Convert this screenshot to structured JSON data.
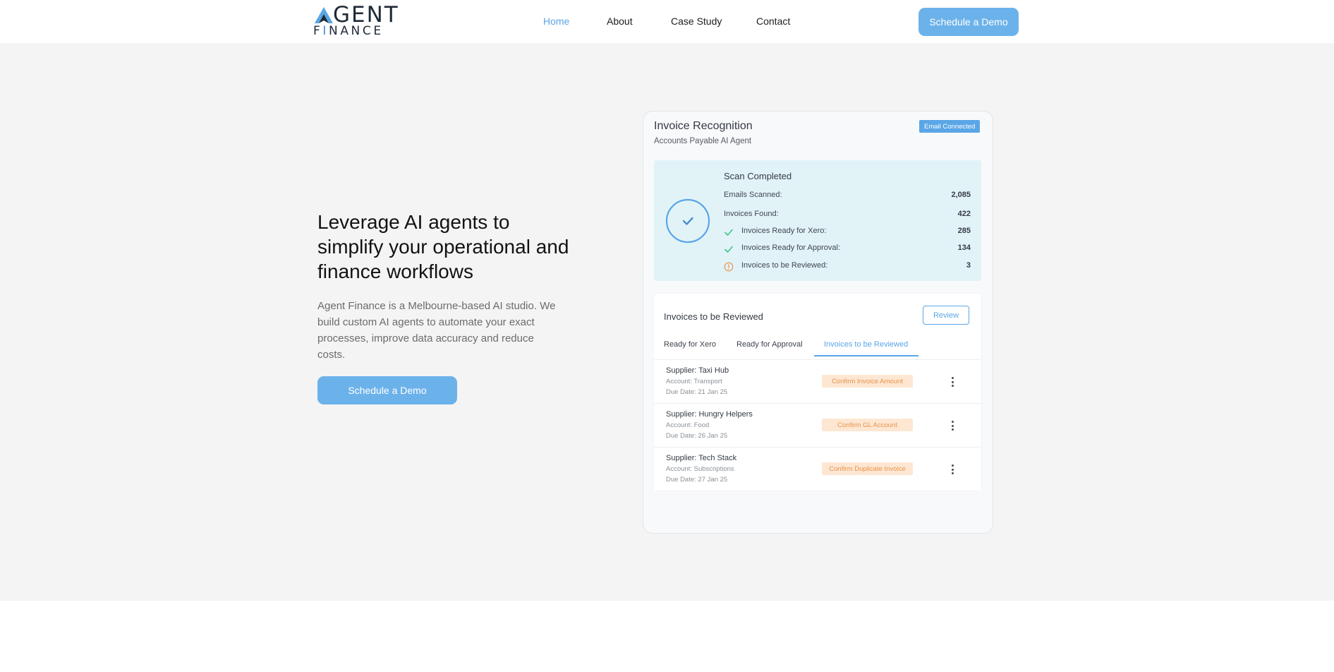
{
  "header": {
    "logo": {
      "top_text": "GENT",
      "bottom_text_pre": "F",
      "bottom_text_i": "I",
      "bottom_text_post": "NANCE",
      "alt": "Agent Finance"
    },
    "nav": [
      {
        "label": "Home",
        "active": true
      },
      {
        "label": "About",
        "active": false
      },
      {
        "label": "Case Study",
        "active": false
      },
      {
        "label": "Contact",
        "active": false
      }
    ],
    "cta_label": "Schedule a Demo"
  },
  "hero": {
    "title": "Leverage AI agents to simplify your operational and finance workflows",
    "description": "Agent Finance is a Melbourne-based AI studio. We build custom AI agents to automate your exact processes, improve data accuracy and reduce costs.",
    "cta_label": "Schedule a Demo"
  },
  "card": {
    "title": "Invoice Recognition",
    "subtitle": "Accounts Payable AI Agent",
    "badge": "Email Connected",
    "scan": {
      "title": "Scan Completed",
      "rows": [
        {
          "label": "Emails Scanned:",
          "value": "2,085",
          "icon": ""
        },
        {
          "label": "Invoices Found:",
          "value": "422",
          "icon": ""
        },
        {
          "label": "Invoices Ready for Xero:",
          "value": "285",
          "icon": "check-icon"
        },
        {
          "label": "Invoices Ready for Approval:",
          "value": "134",
          "icon": "check-icon"
        },
        {
          "label": "Invoices to be Reviewed:",
          "value": "3",
          "icon": "warning-icon"
        }
      ]
    },
    "review": {
      "title": "Invoices to be Reviewed",
      "button_label": "Review",
      "tabs": [
        {
          "label": "Ready for Xero",
          "active": false
        },
        {
          "label": "Ready for Approval",
          "active": false
        },
        {
          "label": "Invoices to be Reviewed",
          "active": true
        }
      ],
      "invoices": [
        {
          "supplier": "Supplier: Taxi Hub",
          "account": "Account: Transport",
          "due": "Due Date: 21 Jan 25",
          "action": "Confirm Invoice Amount"
        },
        {
          "supplier": "Supplier: Hungry Helpers",
          "account": "Account: Food",
          "due": "Due Date: 26 Jan 25",
          "action": "Confirm GL Account"
        },
        {
          "supplier": "Supplier: Tech Stack",
          "account": "Account: Subscriptions",
          "due": "Due Date: 27 Jan 25",
          "action": "Confirm Duplicate Invoice"
        }
      ]
    }
  },
  "colors": {
    "accent": "#6cb2ea",
    "nav_active": "#5ba3e2",
    "hero_bg": "#f4f4f4",
    "scan_bg": "#e2f3f8",
    "check": "#3cc38a",
    "warning": "#e8944a"
  }
}
